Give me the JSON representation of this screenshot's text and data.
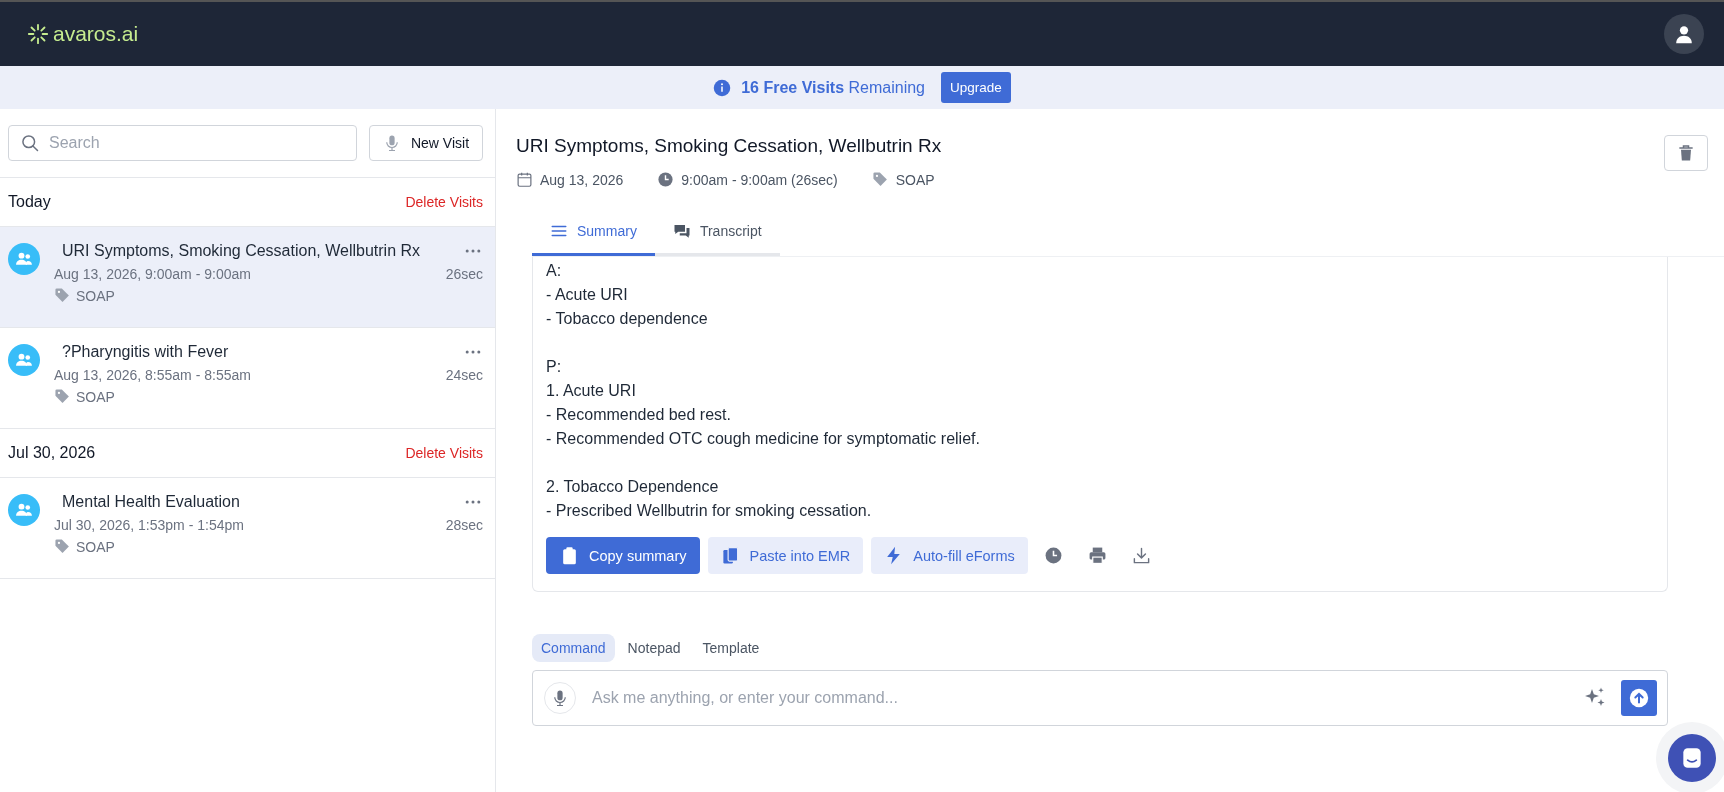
{
  "header": {
    "logo": "avaros.ai"
  },
  "banner": {
    "message": "**16 Free Visits** Remaining",
    "button": "Upgrade"
  },
  "sidebar": {
    "search": {
      "placeholder": "Search"
    },
    "new_visit": "New Visit",
    "groups": [
      {
        "label": "Today",
        "action": "Delete Visits",
        "visits": [
          {
            "title": "URI Symptoms, Smoking Cessation, Wellbutrin Rx",
            "time": "Aug 13, 2026, 9:00am - 9:00am",
            "duration": "26sec",
            "tag": "SOAP",
            "selected": true
          },
          {
            "title": "?Pharyngitis with Fever",
            "time": "Aug 13, 2026, 8:55am - 8:55am",
            "duration": "24sec",
            "tag": "SOAP",
            "selected": false
          }
        ]
      },
      {
        "label": "Jul 30, 2026",
        "action": "Delete Visits",
        "visits": [
          {
            "title": "Mental Health Evaluation",
            "time": "Jul 30, 2026, 1:53pm - 1:54pm",
            "duration": "28sec",
            "tag": "SOAP",
            "selected": false
          }
        ]
      }
    ]
  },
  "visit": {
    "title": "URI Symptoms, Smoking Cessation, Wellbutrin Rx",
    "date": "Aug 13, 2026",
    "time": "9:00am - 9:00am (26sec)",
    "template": "SOAP",
    "tabs": [
      {
        "label": "Summary",
        "selected": true
      },
      {
        "label": "Transcript",
        "selected": false
      }
    ],
    "summary": [
      [
        "A:",
        "- Acute URI",
        "- Tobacco dependence"
      ],
      [
        "P:",
        "1. Acute URI",
        "- Recommended bed rest.",
        "- Recommended OTC cough medicine for symptomatic relief."
      ],
      [
        "2. Tobacco Dependence",
        "- Prescribed Wellbutrin for smoking cessation."
      ]
    ],
    "actions": [
      {
        "label": "Copy summary",
        "kind": "primary"
      },
      {
        "label": "Paste into EMR",
        "kind": "secondary"
      },
      {
        "label": "Auto-fill eForms",
        "kind": "secondary"
      }
    ]
  },
  "composer": {
    "tabs": [
      {
        "label": "Command",
        "selected": true
      },
      {
        "label": "Notepad",
        "selected": false
      },
      {
        "label": "Template",
        "selected": false
      }
    ],
    "placeholder": "Ask me anything, or enter your command..."
  }
}
